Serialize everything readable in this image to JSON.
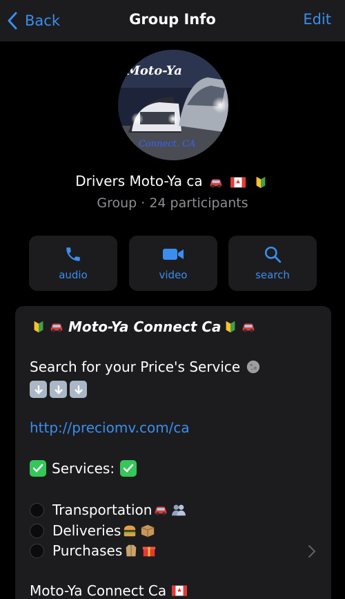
{
  "nav": {
    "back_label": "Back",
    "title": "Group Info",
    "edit_label": "Edit"
  },
  "avatar": {
    "text_top": "Moto-Ya",
    "text_bottom": "Connect. CA"
  },
  "group": {
    "name": "Drivers Moto-Ya ca",
    "subtitle": "Group · 24 participants"
  },
  "actions": [
    {
      "label": "audio",
      "icon": "phone-icon"
    },
    {
      "label": "video",
      "icon": "video-camera-icon"
    },
    {
      "label": "search",
      "icon": "magnifier-icon"
    }
  ],
  "description": {
    "heading": "Moto-Ya Connect Ca",
    "search_line": "Search for your Price's Service",
    "url": "http://preciomv.com/ca",
    "services_label": "Services:",
    "services": [
      "Transportation",
      "Deliveries",
      "Purchases"
    ],
    "footer": "Moto-Ya Connect Ca"
  },
  "colors": {
    "accent": "#3a8ef0",
    "background": "#000000",
    "panel": "#1c1c1e",
    "secondary_text": "#8e8e93"
  }
}
